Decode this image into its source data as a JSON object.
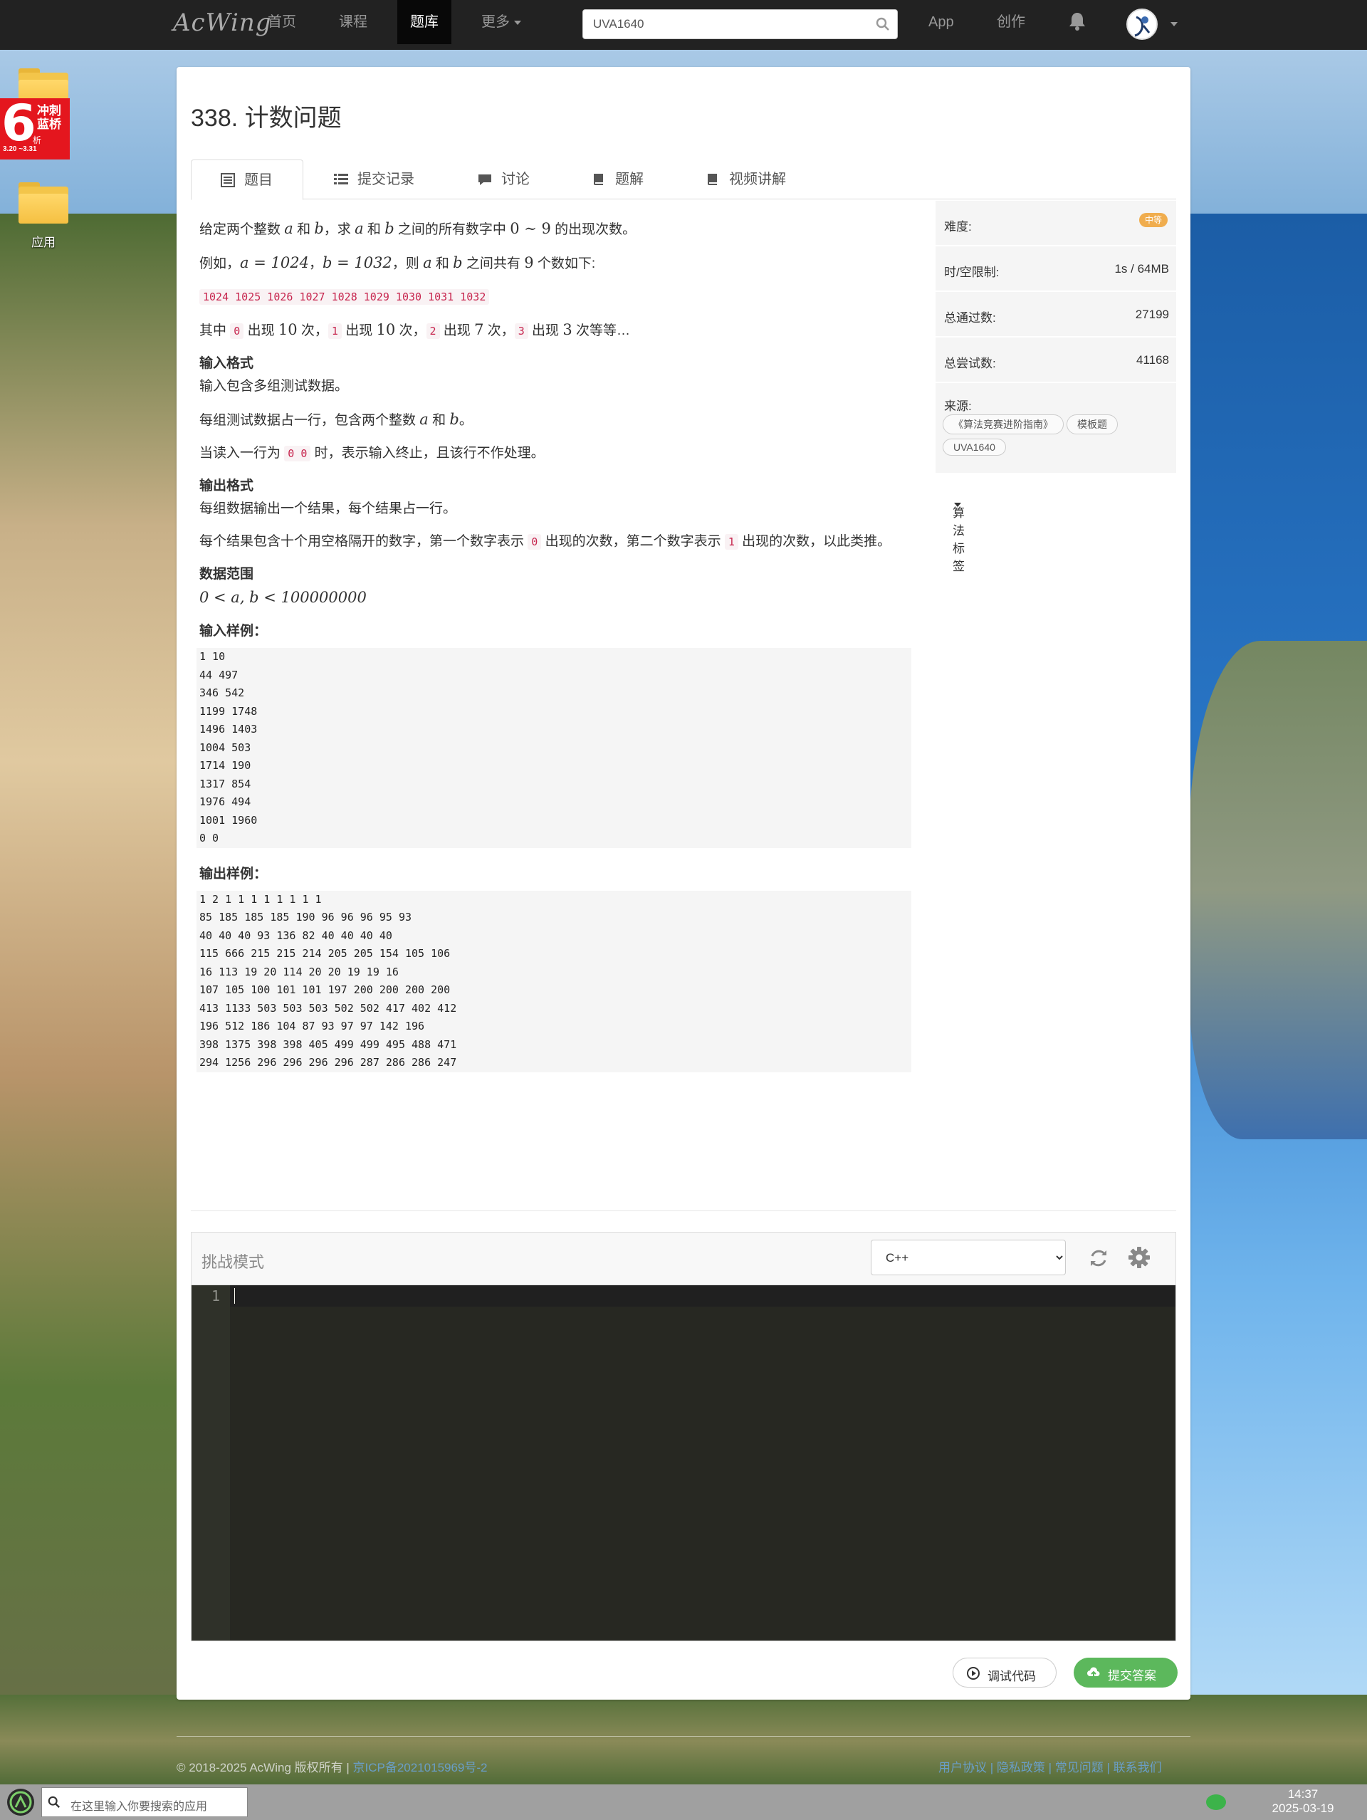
{
  "nav": {
    "logo": "AcWing",
    "items": [
      {
        "label": "首页"
      },
      {
        "label": "课程"
      },
      {
        "label": "题库"
      },
      {
        "label": "更多"
      }
    ],
    "search_value": "UVA1640",
    "app_label": "App",
    "create_label": "创作"
  },
  "desktop": {
    "promo": {
      "big": "6",
      "line1": "冲刺",
      "line2": "蓝桥",
      "line3": "析",
      "dates": "3.20 ~3.31"
    },
    "folder_label": "应用"
  },
  "problem": {
    "title": "338. 计数问题",
    "tabs": [
      {
        "label": "题目"
      },
      {
        "label": "提交记录"
      },
      {
        "label": "讨论"
      },
      {
        "label": "题解"
      },
      {
        "label": "视频讲解"
      }
    ],
    "p1": {
      "a": "给定两个整数 ",
      "b": " 和 ",
      "c": "，求 ",
      "d": " 和 ",
      "e": " 之间的所有数字中 ",
      "f": " 的出现次数。",
      "va": "a",
      "vb": "b",
      "range": "0 ∼ 9"
    },
    "p2": {
      "a": "例如，",
      "b": "，",
      "c": "，则 ",
      "d": " 和 ",
      "e": " 之间共有 ",
      "f": " 个数如下:",
      "eq1": "a = 1024",
      "eq2": "b = 1032",
      "va": "a",
      "vb": "b",
      "n": "9"
    },
    "p3": {
      "code": "1024 1025 1026 1027 1028 1029 1030 1031 1032"
    },
    "p4": {
      "a": "其中 ",
      "c0": "0",
      "b": " 出现 ",
      "n0": "10",
      "c": " 次，",
      "c1": "1",
      "d": " 出现 ",
      "n1": "10",
      "e": " 次，",
      "c2": "2",
      "f": " 出现 ",
      "n2": "7",
      "g": " 次，",
      "c3": "3",
      "h": " 出现 ",
      "n3": "3",
      "i": " 次等等…"
    },
    "input_heading": "输入格式",
    "in1": "输入包含多组测试数据。",
    "in2": {
      "a": "每组测试数据占一行，包含两个整数 ",
      "b": " 和 ",
      "c": "。",
      "va": "a",
      "vb": "b"
    },
    "in3": {
      "a": "当读入一行为 ",
      "code": "0 0",
      "b": " 时，表示输入终止，且该行不作处理。"
    },
    "output_heading": "输出格式",
    "out1": "每组数据输出一个结果，每个结果占一行。",
    "out2": {
      "a": "每个结果包含十个用空格隔开的数字，第一个数字表示 ",
      "c0": "0",
      "b": " 出现的次数，第二个数字表示 ",
      "c1": "1",
      "c": " 出现的次数，以此类推。"
    },
    "range_heading": "数据范围",
    "range_expr": "0 < a, b < 100000000",
    "sample_in_heading": "输入样例：",
    "sample_in": "1 10\n44 497\n346 542\n1199 1748\n1496 1403\n1004 503\n1714 190\n1317 854\n1976 494\n1001 1960\n0 0",
    "sample_out_heading": "输出样例：",
    "sample_out": "1 2 1 1 1 1 1 1 1 1\n85 185 185 185 190 96 96 96 95 93\n40 40 40 93 136 82 40 40 40 40\n115 666 215 215 214 205 205 154 105 106\n16 113 19 20 114 20 20 19 19 16\n107 105 100 101 101 197 200 200 200 200\n413 1133 503 503 503 502 502 417 402 412\n196 512 186 104 87 93 97 97 142 196\n398 1375 398 398 405 499 499 495 488 471\n294 1256 296 296 296 296 287 286 286 247"
  },
  "sidebar": {
    "difficulty_label": "难度:",
    "difficulty_value": "中等",
    "limit_label": "时/空限制:",
    "limit_value": "1s / 64MB",
    "passed_label": "总通过数:",
    "passed_value": "27199",
    "tried_label": "总尝试数:",
    "tried_value": "41168",
    "source_label": "来源:",
    "tags": [
      "《算法竞赛进阶指南》",
      "模板题",
      "UVA1640"
    ],
    "algo_label": "算法标签"
  },
  "editor": {
    "mode_label": "挑战模式",
    "language": "C++",
    "line_number": "1",
    "debug_label": "调试代码",
    "submit_label": "提交答案"
  },
  "footer": {
    "copyright": "© 2018-2025 AcWing 版权所有 | ",
    "icp": "京ICP备2021015969号-2",
    "links": "用户协议 | 隐私政策 | 常见问题 | 联系我们"
  },
  "taskbar": {
    "search_placeholder": "在这里输入你要搜索的应用",
    "time": "14:37",
    "date": "2025-03-19"
  },
  "colors": {
    "nav_bg": "#222222",
    "accent_green": "#5cb85c",
    "badge_orange": "#f0ad4e",
    "editor_bg": "#272822"
  }
}
